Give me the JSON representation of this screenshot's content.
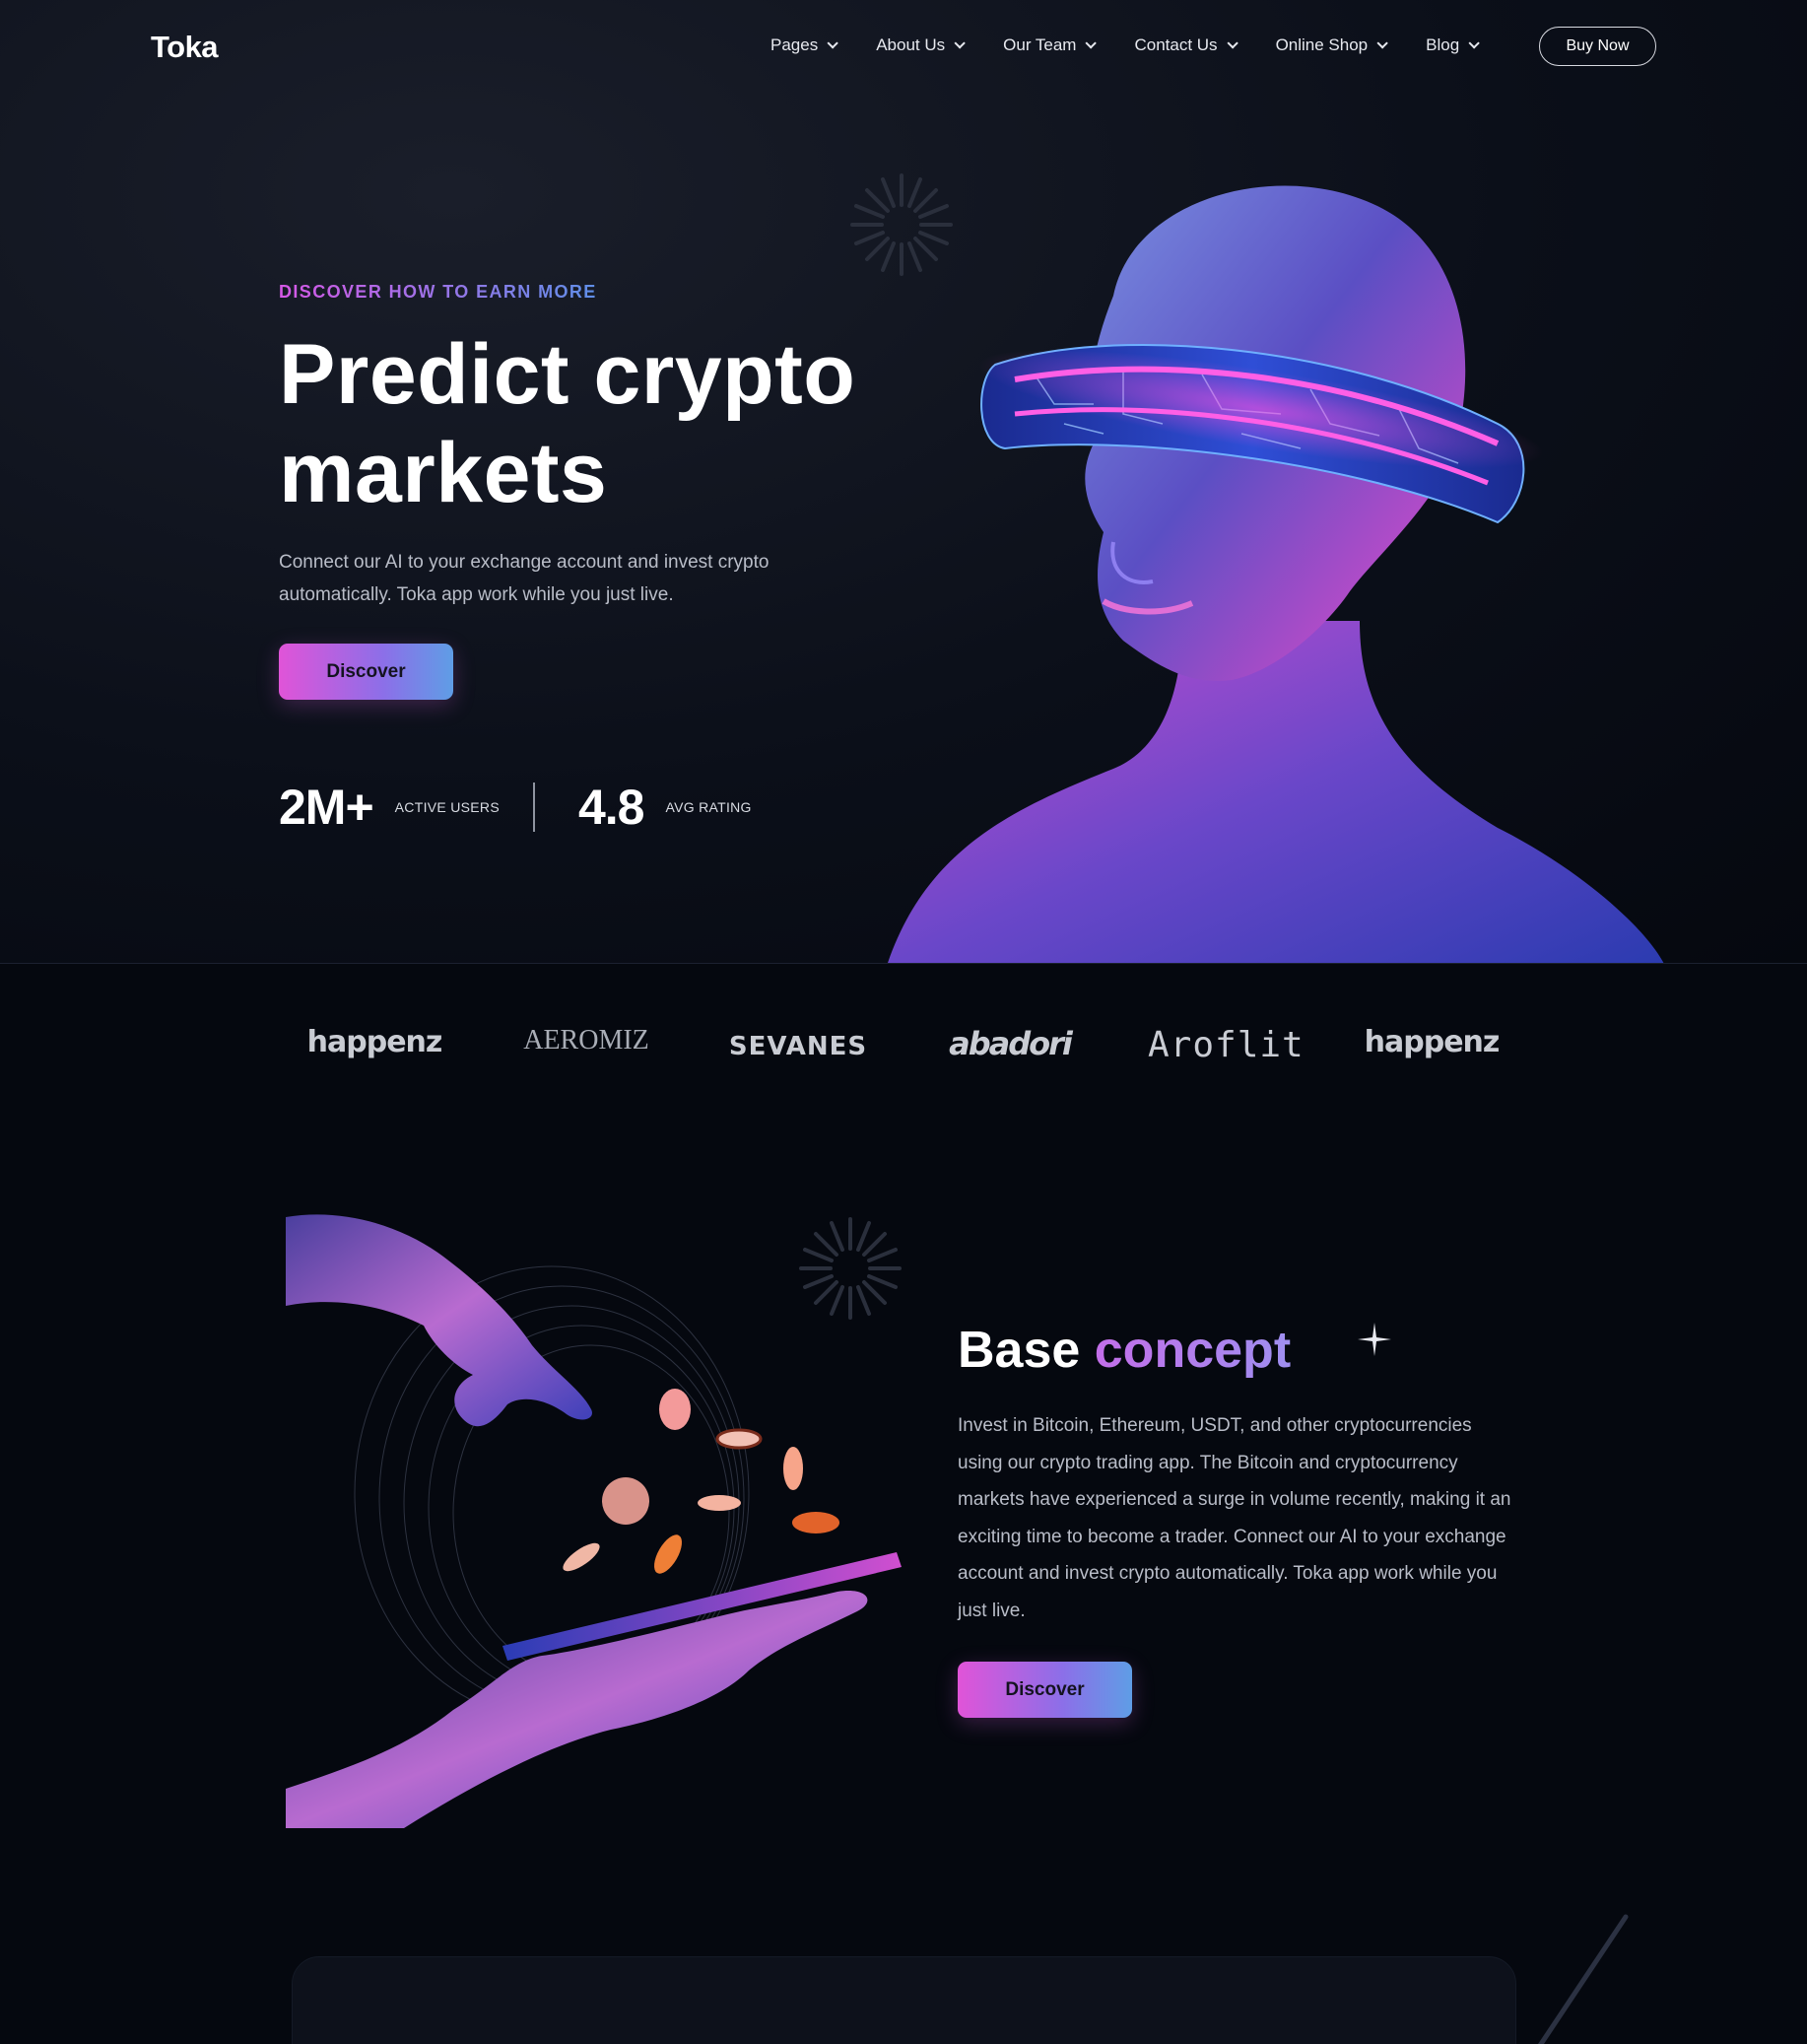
{
  "brand": {
    "logo_text": "Toka"
  },
  "nav": {
    "items": [
      {
        "label": "Pages"
      },
      {
        "label": "About Us"
      },
      {
        "label": "Our Team"
      },
      {
        "label": "Contact Us"
      },
      {
        "label": "Online Shop"
      },
      {
        "label": "Blog"
      }
    ],
    "buy_label": "Buy Now"
  },
  "hero": {
    "eyebrow": "DISCOVER HOW TO EARN MORE",
    "title_line1": "Predict crypto",
    "title_line2": "markets",
    "lead": "Connect our AI to your exchange account and invest crypto automatically. Toka app work while you just live.",
    "cta_label": "Discover",
    "stats": [
      {
        "value": "2M+",
        "label": "ACTIVE USERS"
      },
      {
        "value": "4.8",
        "label": "AVG RATING"
      }
    ]
  },
  "partners": [
    "happenz",
    "AEROMIZ",
    "SEVANES",
    "abadori",
    "Aroflit",
    "happenz"
  ],
  "concept": {
    "title_plain": "Base",
    "title_accent": "concept",
    "body": "Invest in Bitcoin, Ethereum, USDT, and other cryptocurrencies using our crypto trading app. The Bitcoin and cryptocurrency markets have experienced a surge in volume recently, making it an exciting time to become a trader. Connect our AI to your exchange account and invest crypto automatically. Toka app work while you just live.",
    "cta_label": "Discover"
  },
  "colors": {
    "background": "#05080f",
    "accent_pink": "#e054d8",
    "accent_blue": "#5f9de6",
    "text_muted": "#b9bdc8"
  },
  "icons": {
    "chevron": "chevron-down-icon",
    "burst": "starburst-icon",
    "sparkle": "sparkle-icon"
  }
}
